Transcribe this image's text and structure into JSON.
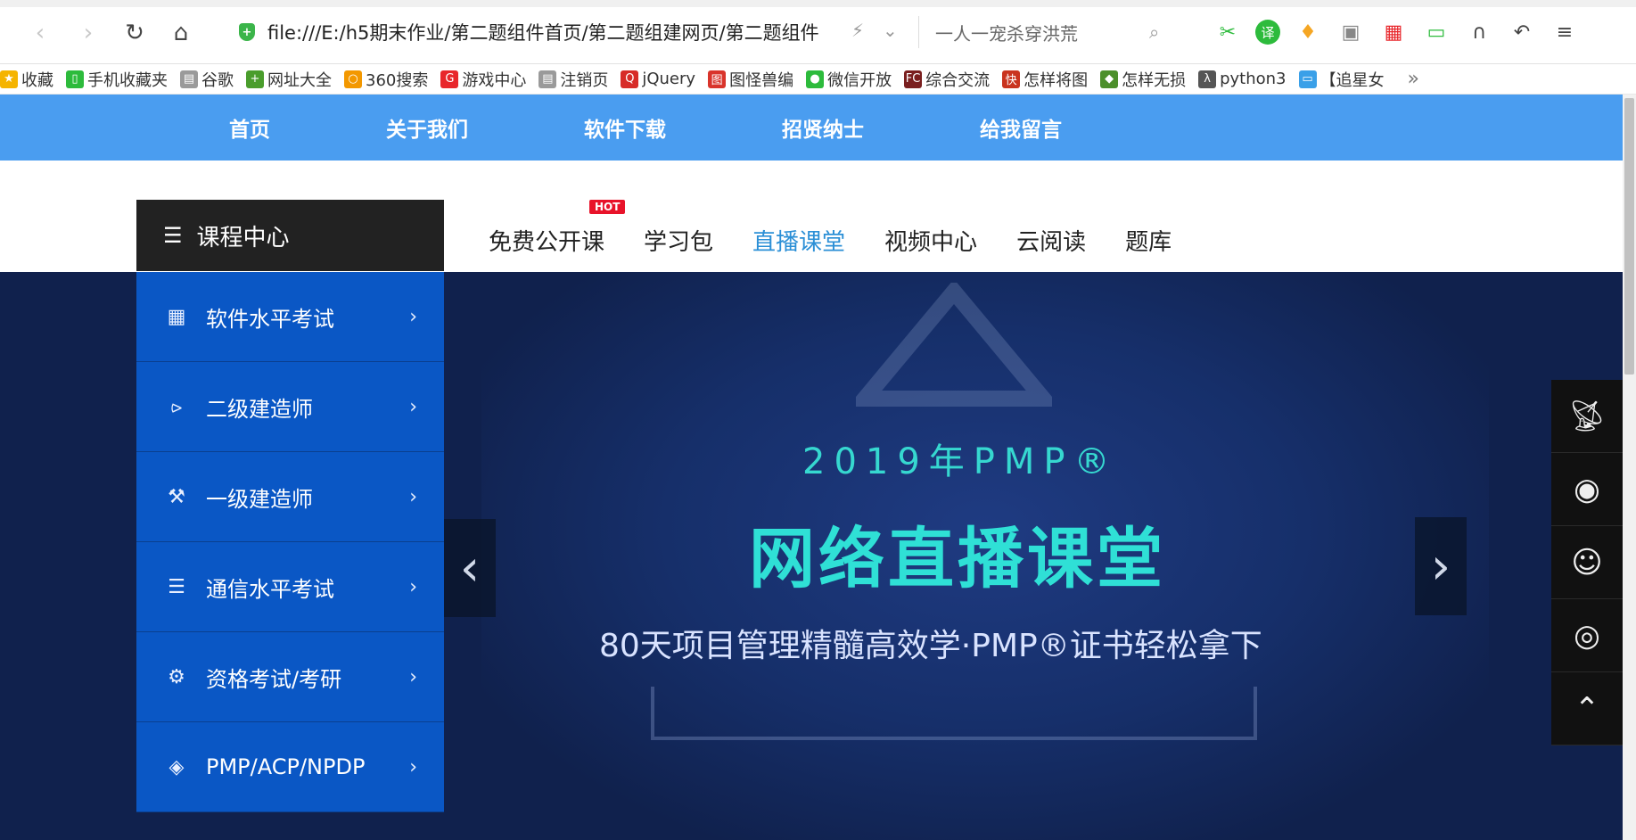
{
  "browser": {
    "address": "file:///E:/h5期末作业/第二题组件首页/第二题组建网页/第二题组件",
    "search_value": "一人一宠杀穿洪荒",
    "bookmarks": [
      {
        "label": "收藏",
        "icon": "star-icon",
        "color": "#f5b400"
      },
      {
        "label": "手机收藏夹",
        "icon": "phone-icon",
        "color": "#2dbb3c"
      },
      {
        "label": "谷歌",
        "icon": "page-icon",
        "color": "#9a9a9a"
      },
      {
        "label": "网址大全",
        "icon": "plus-circle-icon",
        "color": "#4a9d2c"
      },
      {
        "label": "360搜索",
        "icon": "360-icon",
        "color": "#f39800"
      },
      {
        "label": "游戏中心",
        "icon": "game-icon",
        "color": "#e8262b"
      },
      {
        "label": "注销页",
        "icon": "page-icon",
        "color": "#9a9a9a"
      },
      {
        "label": "jQuery",
        "icon": "jquery-icon",
        "color": "#d72b28"
      },
      {
        "label": "图怪兽编",
        "icon": "image-icon",
        "color": "#d9342b"
      },
      {
        "label": "微信开放",
        "icon": "wechat-icon",
        "color": "#2dbb3c"
      },
      {
        "label": "综合交流",
        "icon": "fc-icon",
        "color": "#7a1f1f"
      },
      {
        "label": "怎样将图",
        "icon": "kuai-icon",
        "color": "#c9341f"
      },
      {
        "label": "怎样无损",
        "icon": "leaf-icon",
        "color": "#4c8f2b"
      },
      {
        "label": "python3",
        "icon": "lambda-icon",
        "color": "#555555"
      },
      {
        "label": "【追星女",
        "icon": "tv-icon",
        "color": "#3aa0e8"
      }
    ]
  },
  "topnav": [
    "首页",
    "关于我们",
    "软件下载",
    "招贤纳士",
    "给我留言"
  ],
  "category_header": "课程中心",
  "subnav": {
    "items": [
      "免费公开课",
      "学习包",
      "直播课堂",
      "视频中心",
      "云阅读",
      "题库"
    ],
    "active": "直播课堂",
    "hot_badge": "HOT"
  },
  "side_menu": [
    {
      "label": "软件水平考试",
      "icon": "grid-icon"
    },
    {
      "label": "二级建造师",
      "icon": "tie-icon"
    },
    {
      "label": "一级建造师",
      "icon": "tools-icon"
    },
    {
      "label": "通信水平考试",
      "icon": "server-icon"
    },
    {
      "label": "资格考试/考研",
      "icon": "gear-icon"
    },
    {
      "label": "PMP/ACP/NPDP",
      "icon": "layers-icon"
    }
  ],
  "banner": {
    "year_line": "2019年PMP®",
    "title": "网络直播课堂",
    "subtitle": "80天项目管理精髓高效学·PMP®证书轻松拿下"
  },
  "right_bar": [
    "broadcast-icon",
    "location-icon",
    "qq-icon",
    "weibo-icon",
    "back-to-top-icon"
  ]
}
